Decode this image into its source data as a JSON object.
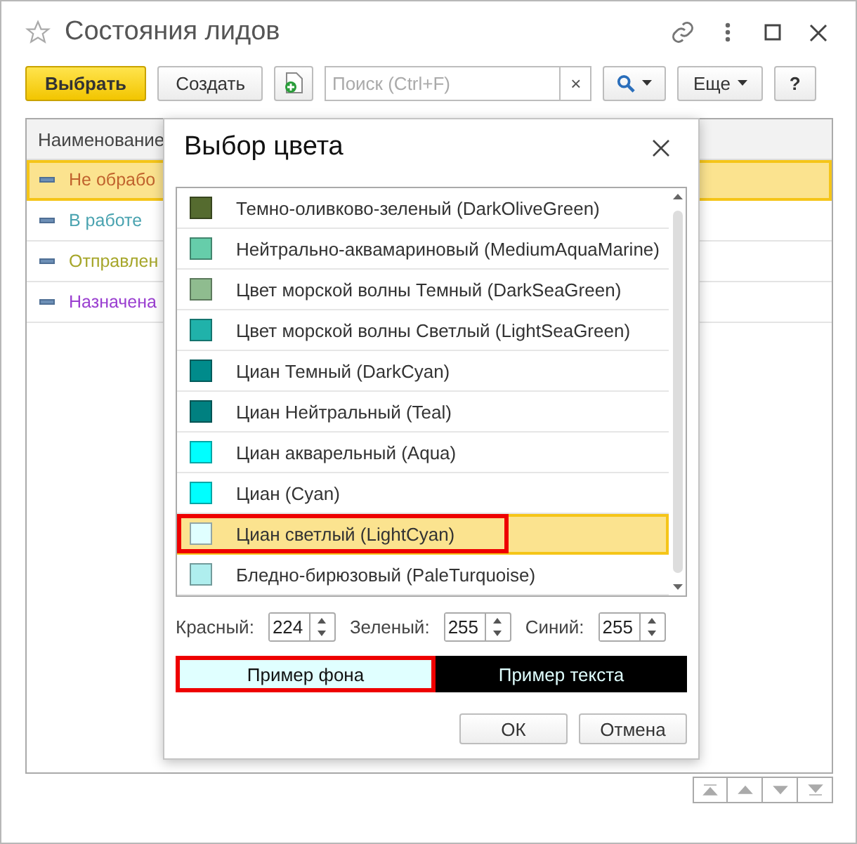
{
  "window": {
    "title": "Состояния лидов",
    "favorite": false
  },
  "toolbar": {
    "select_button": "Выбрать",
    "create_button": "Создать",
    "search": {
      "placeholder": "Поиск (Ctrl+F)",
      "clear": "×"
    },
    "more_button": "Еще",
    "help_button": "?"
  },
  "table": {
    "columns": [
      "Наименование"
    ],
    "rows": [
      {
        "name": "Не обрабо",
        "color": "#c0622d",
        "selected": true
      },
      {
        "name": "В работе",
        "color": "#4aa3b0",
        "selected": false
      },
      {
        "name": "Отправлен",
        "color": "#a6a62a",
        "selected": false
      },
      {
        "name": "Назначена",
        "color": "#9a3fd0",
        "selected": false
      }
    ]
  },
  "dialog": {
    "title": "Выбор цвета",
    "colors": [
      {
        "name": "Темно-оливково-зеленый (DarkOliveGreen)",
        "color": "#556b2f",
        "selected": false,
        "marked": false
      },
      {
        "name": "Нейтрально-аквамариновый (MediumAquaMarine)",
        "color": "#66cdaa",
        "selected": false,
        "marked": false
      },
      {
        "name": "Цвет морской волны Темный (DarkSeaGreen)",
        "color": "#8fbc8f",
        "selected": false,
        "marked": false
      },
      {
        "name": "Цвет морской волны Светлый (LightSeaGreen)",
        "color": "#20b2aa",
        "selected": false,
        "marked": false
      },
      {
        "name": "Циан Темный (DarkCyan)",
        "color": "#008b8b",
        "selected": false,
        "marked": false
      },
      {
        "name": "Циан Нейтральный (Teal)",
        "color": "#008080",
        "selected": false,
        "marked": false
      },
      {
        "name": "Циан акварельный (Aqua)",
        "color": "#00ffff",
        "selected": false,
        "marked": false
      },
      {
        "name": "Циан (Cyan)",
        "color": "#00ffff",
        "selected": false,
        "marked": false
      },
      {
        "name": "Циан светлый (LightCyan)",
        "color": "#e0ffff",
        "selected": true,
        "marked": true
      },
      {
        "name": "Бледно-бирюзовый (PaleTurquoise)",
        "color": "#afeeee",
        "selected": false,
        "marked": false
      }
    ],
    "components": [
      {
        "label": "Красный:",
        "value": "224"
      },
      {
        "label": "Зеленый:",
        "value": "255"
      },
      {
        "label": "Синий:",
        "value": "255"
      }
    ],
    "background_sample": {
      "text": "Пример фона",
      "marked": true
    },
    "text_sample": {
      "text": "Пример текста"
    },
    "buttons": [
      "ОК",
      "Отмена"
    ]
  }
}
